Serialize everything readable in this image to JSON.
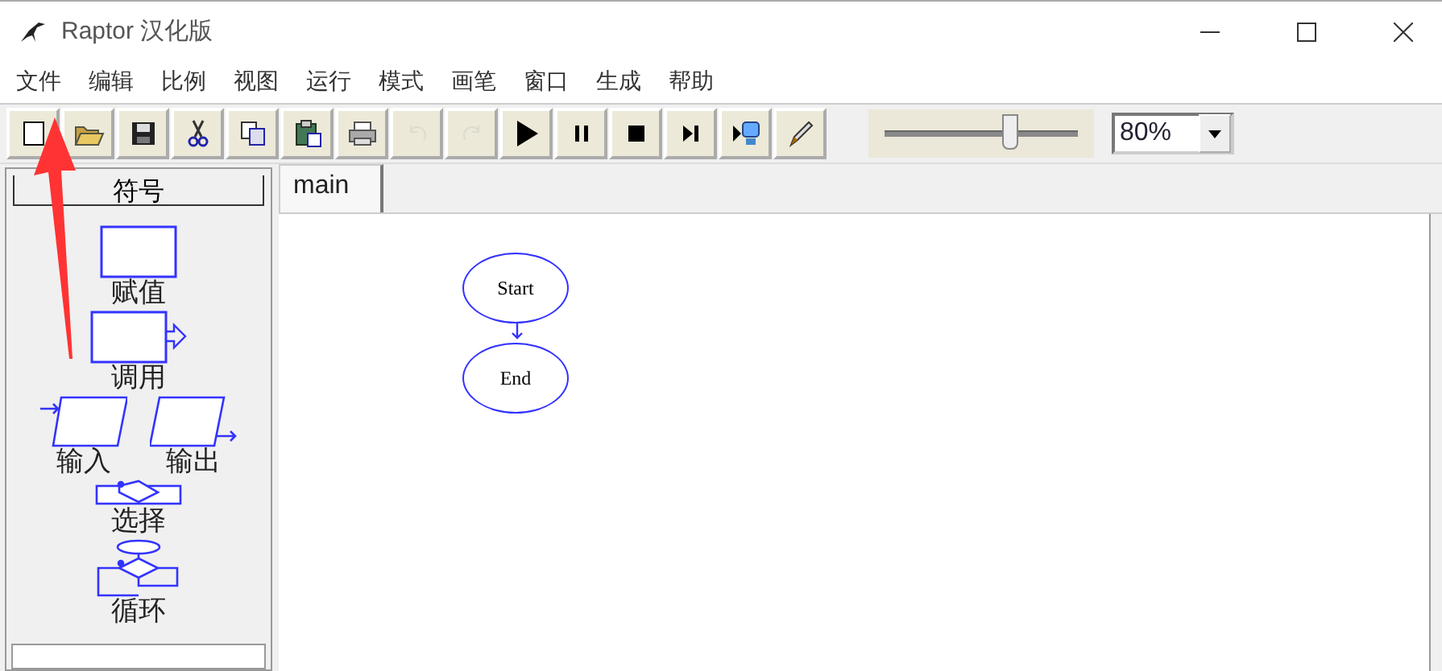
{
  "window": {
    "title": "Raptor 汉化版"
  },
  "menu": [
    "文件",
    "编辑",
    "比例",
    "视图",
    "运行",
    "模式",
    "画笔",
    "窗口",
    "生成",
    "帮助"
  ],
  "toolbar": [
    {
      "kind": "new",
      "disabled": false
    },
    {
      "kind": "open",
      "disabled": false
    },
    {
      "kind": "save",
      "disabled": false
    },
    {
      "kind": "cut",
      "disabled": false
    },
    {
      "kind": "copy",
      "disabled": false
    },
    {
      "kind": "paste",
      "disabled": false
    },
    {
      "kind": "print",
      "disabled": false
    },
    {
      "kind": "undo",
      "disabled": true
    },
    {
      "kind": "redo",
      "disabled": true
    },
    {
      "kind": "play",
      "disabled": false
    },
    {
      "kind": "pause",
      "disabled": false
    },
    {
      "kind": "stop",
      "disabled": false
    },
    {
      "kind": "step",
      "disabled": false
    },
    {
      "kind": "monitor",
      "disabled": false
    },
    {
      "kind": "pen",
      "disabled": false
    }
  ],
  "speed_slider": {
    "level": 0.64
  },
  "zoom": {
    "value": "80%"
  },
  "symbols": {
    "title": "符号",
    "items": [
      {
        "kind": "assign",
        "label": "赋值"
      },
      {
        "kind": "call",
        "label": "调用"
      },
      {
        "kind": "input",
        "label": "输入"
      },
      {
        "kind": "output",
        "label": "输出"
      },
      {
        "kind": "select",
        "label": "选择"
      },
      {
        "kind": "loop",
        "label": "循环"
      }
    ]
  },
  "tabs": [
    {
      "label": "main",
      "selected": true
    }
  ],
  "flowchart": {
    "nodes": [
      {
        "label": "Start"
      },
      {
        "label": "End"
      }
    ]
  }
}
